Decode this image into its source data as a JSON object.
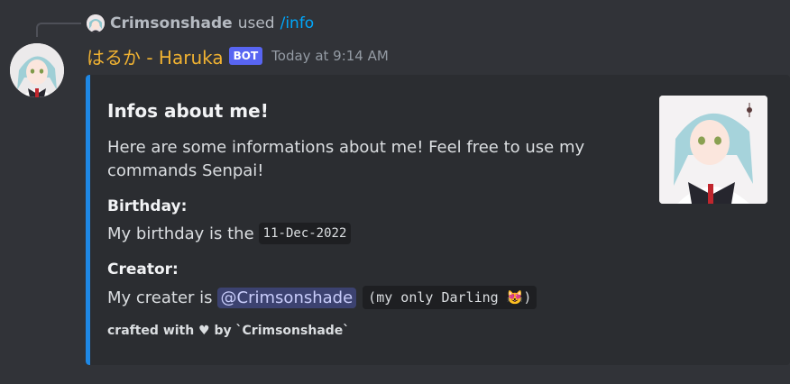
{
  "reply": {
    "username": "Crimsonshade",
    "used_text": "used",
    "command": "/info"
  },
  "message": {
    "username": "はるか - Haruka",
    "bot_tag": "BOT",
    "timestamp": "Today at 9:14 AM",
    "username_color": "#f0b232"
  },
  "embed": {
    "accent_color": "#1e88e5",
    "title": "Infos about me!",
    "description": "Here are some informations about me! Feel free to use my commands Senpai!",
    "fields": [
      {
        "name": "Birthday:",
        "value_text": "My birthday is the",
        "value_code": "11-Dec-2022"
      },
      {
        "name": "Creator:",
        "value_text": "My creater is",
        "value_mention": "@Crimsonshade",
        "value_code": "(my only Darling 😻)"
      }
    ],
    "footer": "crafted with ♥ by `Crimsonshade`"
  },
  "icons": {
    "avatar": "anime-girl-avatar",
    "reply_avatar": "anime-girl-avatar",
    "thumbnail": "anime-girl-thumbnail"
  }
}
